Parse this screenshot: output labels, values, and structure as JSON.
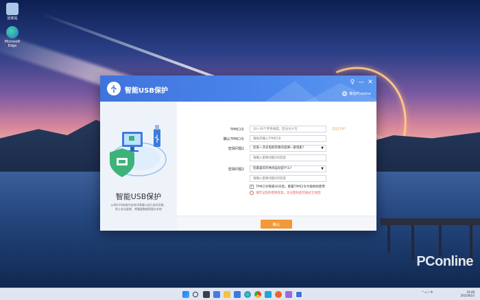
{
  "desktop": {
    "icons": [
      {
        "label": "回收站",
        "icon": "recycle-bin-icon",
        "color": "#a9c7e8"
      },
      {
        "label": "Microsoft Edge",
        "icon": "edge-icon",
        "color": "#1fa2a0"
      }
    ],
    "watermark": "PConline"
  },
  "dialog": {
    "title": "智能USB保护",
    "controls": {
      "pin": "♀",
      "minimize": "—",
      "close": "✕"
    },
    "account": "微信PConline",
    "brand": "智能USB保护",
    "description": "从Win10系统中支持USB端口自行访问切换，防止非法复制，将重要数据保管在本地",
    "form": {
      "tpm_pin": {
        "label": "TPM口令",
        "placeholder": "10~16个字符组成，区分大小写"
      },
      "tpm_pin_hint": "忘记口令?",
      "confirm_pin": {
        "label": "确认TPM口令",
        "placeholder": "请再次输入TPM口令"
      },
      "question1": {
        "label": "密保问题1",
        "value": "您第一次去电影院看的是哪一部电影?"
      },
      "answer1": {
        "placeholder": "请输入密保问题1的答案"
      },
      "question2": {
        "label": "密保问题2",
        "value": "您最喜欢的休闲运动是什么?"
      },
      "answer2": {
        "placeholder": "请输入密保问题2的答案"
      },
      "agreement": "TPM口令每隔30天后，重置TPM口令才能继续使用",
      "warning": "请牢记您的密保答案，忘记密码后可通过它找回"
    },
    "confirm_button": "确认"
  },
  "taskbar": {
    "icons": [
      "start-icon",
      "search-icon",
      "task-view-icon",
      "widgets-icon",
      "file-explorer-icon",
      "store-icon",
      "edge-icon",
      "chrome-icon",
      "app-icon-1",
      "app-icon-2",
      "app-icon-3",
      "app-icon-4",
      "app-icon-5",
      "app-icon-6",
      "app-icon-7"
    ],
    "time": "19:48",
    "date": "2022/8/23"
  },
  "colors": {
    "titlebar": "#3f74dc",
    "accent_orange": "#f2993a",
    "warning_red": "#e55555"
  }
}
